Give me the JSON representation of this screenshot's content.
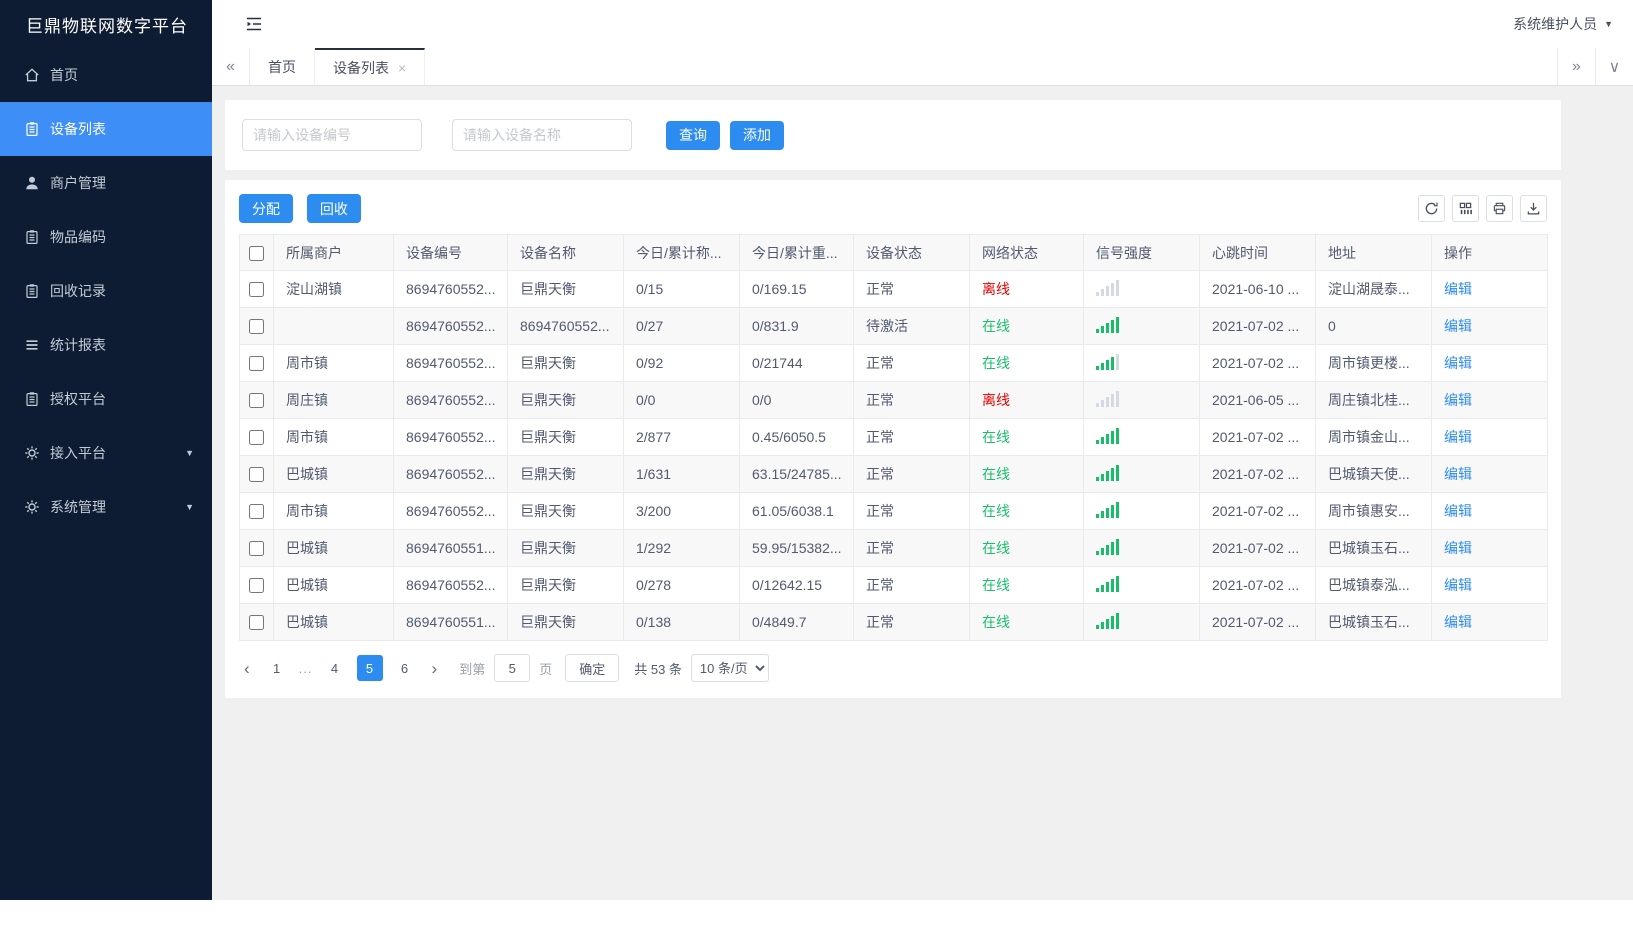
{
  "app": {
    "title": "巨鼎物联网数字平台",
    "user_menu": "系统维护人员"
  },
  "icons": {
    "menu_caret": "▼",
    "user_caret": "▼",
    "tabs_scroll_left": "«",
    "tabs_scroll_right": "»",
    "tabs_menu": "∨",
    "tab_close": "×",
    "prev_page": "‹",
    "next_page": "›"
  },
  "sidebar": {
    "items": [
      {
        "key": "home",
        "label": "首页",
        "icon": "home",
        "active": false,
        "expandable": false
      },
      {
        "key": "device-list",
        "label": "设备列表",
        "icon": "doc",
        "active": true,
        "expandable": false
      },
      {
        "key": "merchant-mgmt",
        "label": "商户管理",
        "icon": "user",
        "active": false,
        "expandable": false
      },
      {
        "key": "item-code",
        "label": "物品编码",
        "icon": "doc",
        "active": false,
        "expandable": false
      },
      {
        "key": "recycle-records",
        "label": "回收记录",
        "icon": "doc",
        "active": false,
        "expandable": false
      },
      {
        "key": "stats-report",
        "label": "统计报表",
        "icon": "list",
        "active": false,
        "expandable": false
      },
      {
        "key": "auth-platform",
        "label": "授权平台",
        "icon": "doc",
        "active": false,
        "expandable": false
      },
      {
        "key": "access-platform",
        "label": "接入平台",
        "icon": "gear",
        "active": false,
        "expandable": true
      },
      {
        "key": "system-mgmt",
        "label": "系统管理",
        "icon": "gear",
        "active": false,
        "expandable": true
      }
    ]
  },
  "tabbar": {
    "tabs": [
      {
        "key": "home",
        "label": "首页",
        "active": false,
        "closable": false
      },
      {
        "key": "device-list",
        "label": "设备列表",
        "active": true,
        "closable": true
      }
    ]
  },
  "search": {
    "device_no_placeholder": "请输入设备编号",
    "device_name_placeholder": "请输入设备名称",
    "query_label": "查询",
    "add_label": "添加"
  },
  "toolbar": {
    "assign_label": "分配",
    "recycle_label": "回收"
  },
  "table": {
    "headers": [
      "所属商户",
      "设备编号",
      "设备名称",
      "今日/累计称...",
      "今日/累计重...",
      "设备状态",
      "网络状态",
      "信号强度",
      "心跳时间",
      "地址",
      "操作"
    ],
    "edit_label": "编辑",
    "rows": [
      {
        "merchant": "淀山湖镇",
        "device_no": "8694760552...",
        "device_name": "巨鼎天衡",
        "today_count": "0/15",
        "today_weight": "0/169.15",
        "device_status": "正常",
        "network_status": "离线",
        "online": false,
        "signal": 0,
        "heartbeat": "2021-06-10 ...",
        "address": "淀山湖晟泰..."
      },
      {
        "merchant": "",
        "device_no": "8694760552...",
        "device_name": "8694760552...",
        "today_count": "0/27",
        "today_weight": "0/831.9",
        "device_status": "待激活",
        "network_status": "在线",
        "online": true,
        "signal": 5,
        "heartbeat": "2021-07-02 ...",
        "address": "0"
      },
      {
        "merchant": "周市镇",
        "device_no": "8694760552...",
        "device_name": "巨鼎天衡",
        "today_count": "0/92",
        "today_weight": "0/21744",
        "device_status": "正常",
        "network_status": "在线",
        "online": true,
        "signal": 4,
        "heartbeat": "2021-07-02 ...",
        "address": "周市镇更楼..."
      },
      {
        "merchant": "周庄镇",
        "device_no": "8694760552...",
        "device_name": "巨鼎天衡",
        "today_count": "0/0",
        "today_weight": "0/0",
        "device_status": "正常",
        "network_status": "离线",
        "online": false,
        "signal": 0,
        "heartbeat": "2021-06-05 ...",
        "address": "周庄镇北桂..."
      },
      {
        "merchant": "周市镇",
        "device_no": "8694760552...",
        "device_name": "巨鼎天衡",
        "today_count": "2/877",
        "today_weight": "0.45/6050.5",
        "device_status": "正常",
        "network_status": "在线",
        "online": true,
        "signal": 5,
        "heartbeat": "2021-07-02 ...",
        "address": "周市镇金山..."
      },
      {
        "merchant": "巴城镇",
        "device_no": "8694760552...",
        "device_name": "巨鼎天衡",
        "today_count": "1/631",
        "today_weight": "63.15/24785...",
        "device_status": "正常",
        "network_status": "在线",
        "online": true,
        "signal": 5,
        "heartbeat": "2021-07-02 ...",
        "address": "巴城镇天使..."
      },
      {
        "merchant": "周市镇",
        "device_no": "8694760552...",
        "device_name": "巨鼎天衡",
        "today_count": "3/200",
        "today_weight": "61.05/6038.1",
        "device_status": "正常",
        "network_status": "在线",
        "online": true,
        "signal": 5,
        "heartbeat": "2021-07-02 ...",
        "address": "周市镇惠安..."
      },
      {
        "merchant": "巴城镇",
        "device_no": "8694760551...",
        "device_name": "巨鼎天衡",
        "today_count": "1/292",
        "today_weight": "59.95/15382...",
        "device_status": "正常",
        "network_status": "在线",
        "online": true,
        "signal": 5,
        "heartbeat": "2021-07-02 ...",
        "address": "巴城镇玉石..."
      },
      {
        "merchant": "巴城镇",
        "device_no": "8694760552...",
        "device_name": "巨鼎天衡",
        "today_count": "0/278",
        "today_weight": "0/12642.15",
        "device_status": "正常",
        "network_status": "在线",
        "online": true,
        "signal": 5,
        "heartbeat": "2021-07-02 ...",
        "address": "巴城镇泰泓..."
      },
      {
        "merchant": "巴城镇",
        "device_no": "8694760551...",
        "device_name": "巨鼎天衡",
        "today_count": "0/138",
        "today_weight": "0/4849.7",
        "device_status": "正常",
        "network_status": "在线",
        "online": true,
        "signal": 5,
        "heartbeat": "2021-07-02 ...",
        "address": "巴城镇玉石..."
      }
    ]
  },
  "pagination": {
    "pages": [
      "1",
      "...",
      "4",
      "5",
      "6"
    ],
    "active_page": "5",
    "goto_label": "到第",
    "goto_value": "5",
    "page_unit_label": "页",
    "confirm_label": "确定",
    "total_label": "共 53 条",
    "page_size_label": "10 条/页"
  },
  "colors": {
    "primary": "#2d8cf0",
    "sidebar_active": "#3e8ef7",
    "online_green": "#19be6b",
    "offline_red": "#e60000"
  }
}
